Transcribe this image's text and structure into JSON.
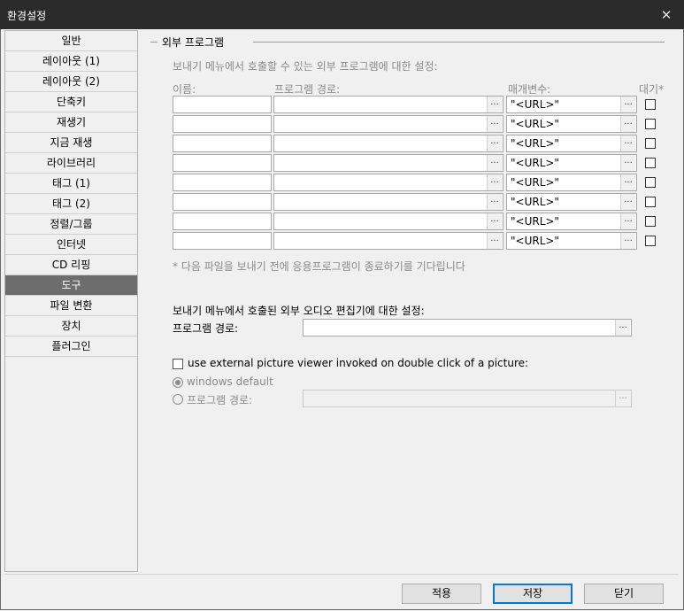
{
  "window": {
    "title": "환경설정",
    "close_icon": "close-icon"
  },
  "sidebar": {
    "items": [
      "일반",
      "레이아웃 (1)",
      "레이아웃 (2)",
      "단축키",
      "재생기",
      "지금 재생",
      "라이브러리",
      "태그 (1)",
      "태그 (2)",
      "정렬/그룹",
      "인터넷",
      "CD 리핑",
      "도구",
      "파일 변환",
      "장치",
      "플러그인"
    ],
    "selected_index": 12
  },
  "ext": {
    "title": "외부 프로그램",
    "description": "보내기 메뉴에서 호출할 수 있는 외부 프로그램에 대한 설정:",
    "col_name": "이름:",
    "col_path": "프로그램 경로:",
    "col_param": "매개변수:",
    "col_wait": "대기*",
    "rows": [
      {
        "name": "",
        "path": "",
        "param": "\"<URL>\"",
        "wait": false
      },
      {
        "name": "",
        "path": "",
        "param": "\"<URL>\"",
        "wait": false
      },
      {
        "name": "",
        "path": "",
        "param": "\"<URL>\"",
        "wait": false
      },
      {
        "name": "",
        "path": "",
        "param": "\"<URL>\"",
        "wait": false
      },
      {
        "name": "",
        "path": "",
        "param": "\"<URL>\"",
        "wait": false
      },
      {
        "name": "",
        "path": "",
        "param": "\"<URL>\"",
        "wait": false
      },
      {
        "name": "",
        "path": "",
        "param": "\"<URL>\"",
        "wait": false
      },
      {
        "name": "",
        "path": "",
        "param": "\"<URL>\"",
        "wait": false
      }
    ],
    "browse_label": "...",
    "footnote": "* 다음 파일을 보내기 전에 응용프로그램이 종료하기를 기다립니다"
  },
  "audio_editor": {
    "description": "보내기 메뉴에서 호출된 외부 오디오 편집기에 대한 설정:",
    "path_label": "프로그램 경로:",
    "path_value": ""
  },
  "picture_viewer": {
    "checkbox_label": "use external picture viewer invoked on double click of a picture:",
    "checked": false,
    "option_default": "windows default",
    "option_path": "프로그램 경로:",
    "path_value": ""
  },
  "buttons": {
    "apply": "적용",
    "save": "저장",
    "close": "닫기"
  },
  "colors": {
    "selected_bg": "#6d6d6d",
    "titlebar": "#2b2b2b",
    "default_button_border": "#0078d7"
  }
}
